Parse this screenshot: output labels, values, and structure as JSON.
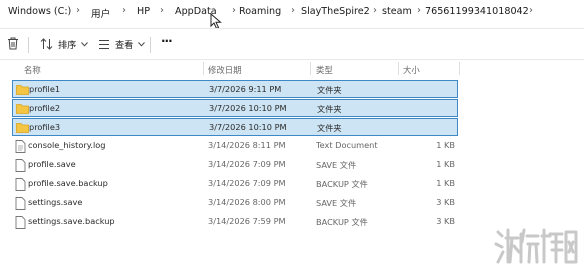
{
  "breadcrumb": {
    "items": [
      "Windows (C:)",
      "用户",
      "HP",
      "AppData",
      "Roaming",
      "SlayTheSpire2",
      "steam",
      "76561199341018042"
    ]
  },
  "toolbar": {
    "sort_label": "排序",
    "view_label": "查看",
    "more_label": "···"
  },
  "columns": {
    "name": "名称",
    "modified": "修改日期",
    "type": "类型",
    "size": "大小"
  },
  "files": [
    {
      "name": "profile1",
      "modified": "3/7/2026 9:11 PM",
      "type": "文件夹",
      "size": "",
      "kind": "folder",
      "selected": true
    },
    {
      "name": "profile2",
      "modified": "3/7/2026 10:10 PM",
      "type": "文件夹",
      "size": "",
      "kind": "folder",
      "selected": true
    },
    {
      "name": "profile3",
      "modified": "3/7/2026 10:10 PM",
      "type": "文件夹",
      "size": "",
      "kind": "folder",
      "selected": true
    },
    {
      "name": "console_history.log",
      "modified": "3/14/2026 8:11 PM",
      "type": "Text Document",
      "size": "1 KB",
      "kind": "file",
      "selected": false
    },
    {
      "name": "profile.save",
      "modified": "3/14/2026 7:09 PM",
      "type": "SAVE 文件",
      "size": "1 KB",
      "kind": "file",
      "selected": false
    },
    {
      "name": "profile.save.backup",
      "modified": "3/14/2026 7:09 PM",
      "type": "BACKUP 文件",
      "size": "1 KB",
      "kind": "file",
      "selected": false
    },
    {
      "name": "settings.save",
      "modified": "3/14/2026 8:00 PM",
      "type": "SAVE 文件",
      "size": "3 KB",
      "kind": "file",
      "selected": false
    },
    {
      "name": "settings.save.backup",
      "modified": "3/14/2026 7:59 PM",
      "type": "BACKUP 文件",
      "size": "3 KB",
      "kind": "file",
      "selected": false
    }
  ],
  "watermark": {
    "text": "游侠网",
    "color": "#c8c8c8"
  },
  "colors": {
    "selection_fill": "#cde4f4",
    "selection_border": "#3d88c6",
    "folder": "#f4c542"
  }
}
